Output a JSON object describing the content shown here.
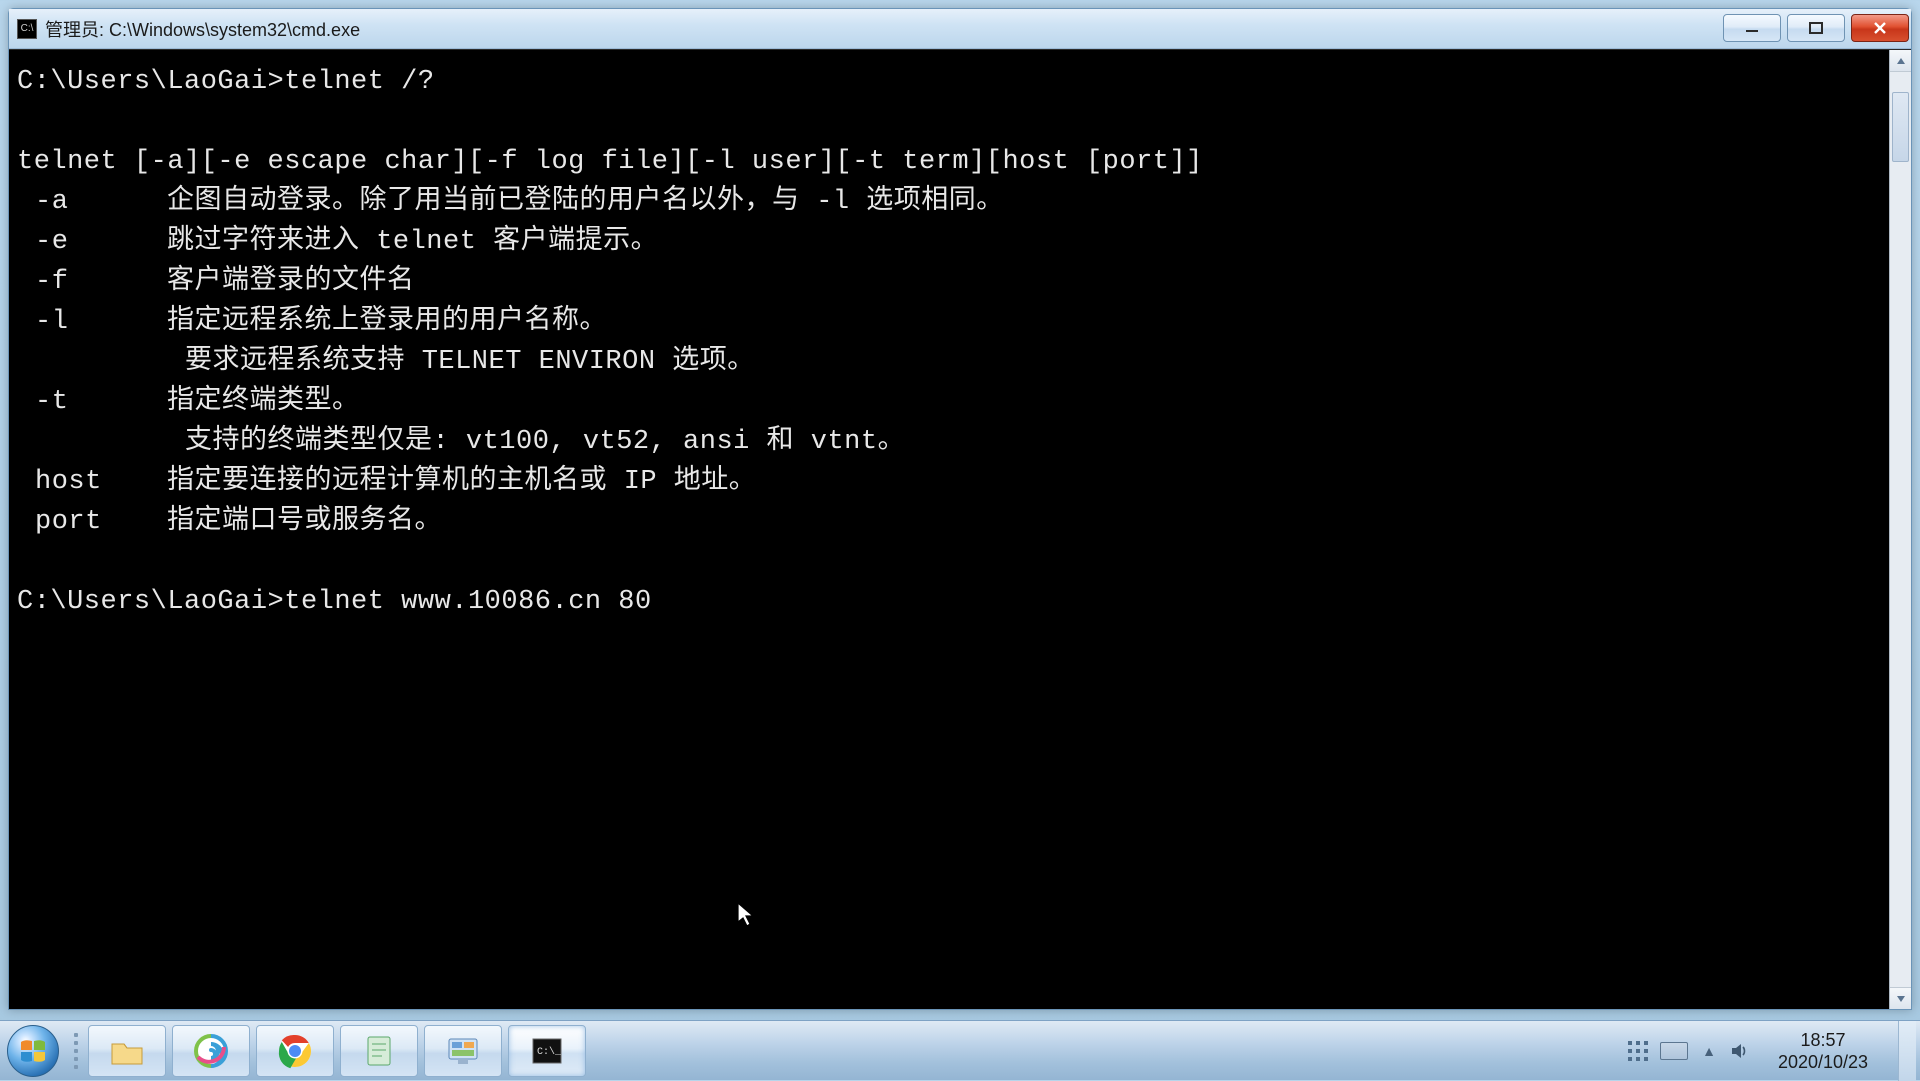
{
  "window": {
    "title": "管理员: C:\\Windows\\system32\\cmd.exe"
  },
  "terminal": {
    "prompt1": "C:\\Users\\LaoGai>",
    "cmd1": "telnet /?",
    "usage": "telnet [-a][-e escape char][-f log file][-l user][-t term][host [port]]",
    "opt_a": "-a",
    "opt_a_desc": "企图自动登录。除了用当前已登陆的用户名以外，与 -l 选项相同。",
    "opt_e": "-e",
    "opt_e_desc": "跳过字符来进入 telnet 客户端提示。",
    "opt_f": "-f",
    "opt_f_desc": "客户端登录的文件名",
    "opt_l": "-l",
    "opt_l_desc": "指定远程系统上登录用的用户名称。",
    "opt_l_desc2": "要求远程系统支持 TELNET ENVIRON 选项。",
    "opt_t": "-t",
    "opt_t_desc": "指定终端类型。",
    "opt_t_desc2": "支持的终端类型仅是: vt100, vt52, ansi 和 vtnt。",
    "opt_host": "host",
    "opt_host_desc": "指定要连接的远程计算机的主机名或 IP 地址。",
    "opt_port": "port",
    "opt_port_desc": "指定端口号或服务名。",
    "prompt2": "C:\\Users\\LaoGai>",
    "cmd2": "telnet www.10086.cn 80"
  },
  "taskbar": {
    "items": [
      {
        "name": "file-explorer"
      },
      {
        "name": "browser-swirl"
      },
      {
        "name": "chrome"
      },
      {
        "name": "notepad"
      },
      {
        "name": "settings-app"
      },
      {
        "name": "cmd"
      }
    ]
  },
  "clock": {
    "time": "18:57",
    "date": "2020/10/23"
  }
}
